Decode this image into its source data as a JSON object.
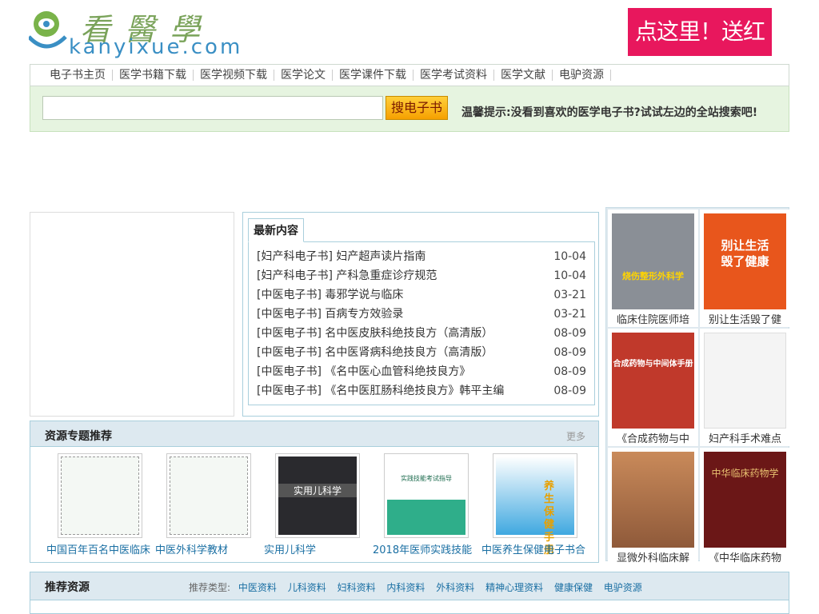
{
  "logo": {
    "cn": "看醫學",
    "en": "kanyixue.com"
  },
  "ad": {
    "text": "点这里！送红包啦"
  },
  "nav": {
    "items": [
      "电子书主页",
      "医学书籍下载",
      "医学视频下载",
      "医学论文",
      "医学课件下载",
      "医学考试资料",
      "医学文献",
      "电驴资源"
    ]
  },
  "search": {
    "value": "",
    "button": "搜电子书",
    "tip": "温馨提示:没看到喜欢的医学电子书?试试左边的全站搜索吧!"
  },
  "latest": {
    "tab": "最新内容",
    "rows": [
      {
        "cat": "[妇产科电子书]",
        "title": "妇产超声读片指南",
        "date": "10-04"
      },
      {
        "cat": "[妇产科电子书]",
        "title": "产科急重症诊疗规范",
        "date": "10-04"
      },
      {
        "cat": "[中医电子书]",
        "title": "毒邪学说与临床",
        "date": "03-21"
      },
      {
        "cat": "[中医电子书]",
        "title": "百病专方效验录",
        "date": "03-21"
      },
      {
        "cat": "[中医电子书]",
        "title": "名中医皮肤科绝技良方（高清版）",
        "date": "08-09"
      },
      {
        "cat": "[中医电子书]",
        "title": "名中医肾病科绝技良方（高清版）",
        "date": "08-09"
      },
      {
        "cat": "[中医电子书]",
        "title": "《名中医心血管科绝技良方》",
        "date": "08-09"
      },
      {
        "cat": "[中医电子书]",
        "title": "《名中医肛肠科绝技良方》韩平主编",
        "date": "08-09"
      }
    ]
  },
  "right_grid": {
    "items": [
      {
        "caption": "临床住院医师培",
        "cover_title": "烧伤整形外科学",
        "color": "#8a8f96"
      },
      {
        "caption": "别让生活毁了健",
        "cover_title": "别让生活毁了健康",
        "color": "#e8561c"
      },
      {
        "caption": "《合成药物与中",
        "cover_title": "合成药物与中间体手册",
        "color": "#c0392b"
      },
      {
        "caption": "妇产科手术难点",
        "cover_title": "",
        "color": "#f4f4f4"
      },
      {
        "caption": "显微外科临床解",
        "cover_title": "",
        "color": "#b8825a"
      },
      {
        "caption": "《中华临床药物",
        "cover_title": "中华临床药物学",
        "color": "#6b1717"
      }
    ]
  },
  "special": {
    "title": "资源专题推荐",
    "more": "更多",
    "items": [
      {
        "caption": "中国百年百名中医临床",
        "cover_title": ""
      },
      {
        "caption": "中医外科学教材",
        "cover_title": ""
      },
      {
        "caption": "实用儿科学",
        "cover_title": "实用儿科学"
      },
      {
        "caption": "2018年医师实践技能",
        "cover_title": "实践技能考试指导"
      },
      {
        "caption": "中医养生保健电子书合",
        "cover_title": "养生保健手册"
      }
    ]
  },
  "recommend": {
    "title": "推荐资源",
    "types_label": "推荐类型:",
    "types": [
      "中医资料",
      "儿科资料",
      "妇科资料",
      "内科资料",
      "外科资料",
      "精神心理资料",
      "健康保健",
      "电驴资源"
    ]
  }
}
